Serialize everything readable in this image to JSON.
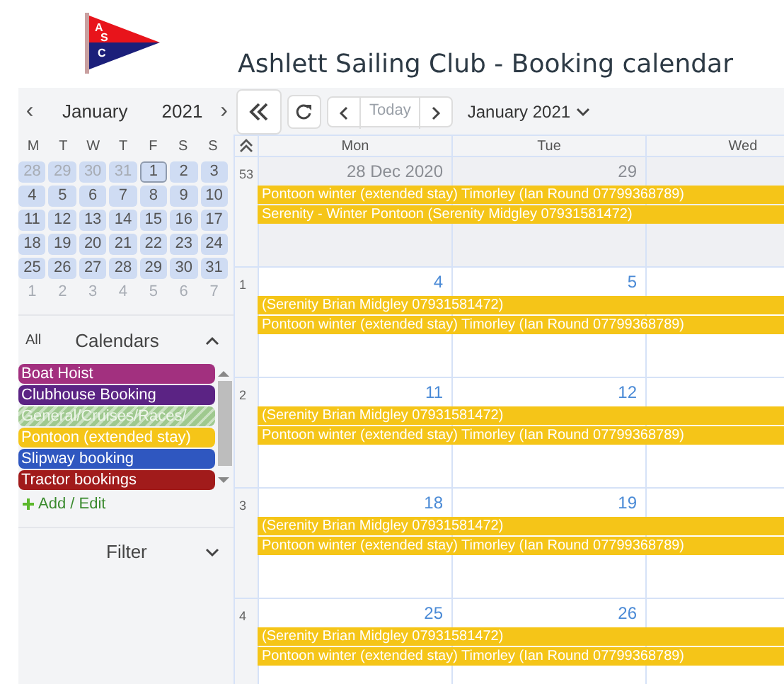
{
  "logo": {
    "letters": [
      "A",
      "S",
      "C"
    ]
  },
  "title": "Ashlett Sailing Club - Booking calendar",
  "mini_calendar": {
    "prev": "‹",
    "month": "January",
    "year": "2021",
    "next": "›",
    "weekdays": [
      "M",
      "T",
      "W",
      "T",
      "F",
      "S",
      "S"
    ],
    "weeks": [
      [
        {
          "day": "28",
          "muted": true,
          "in_range": true,
          "selected": false
        },
        {
          "day": "29",
          "muted": true,
          "in_range": true,
          "selected": false
        },
        {
          "day": "30",
          "muted": true,
          "in_range": true,
          "selected": false
        },
        {
          "day": "31",
          "muted": true,
          "in_range": true,
          "selected": false
        },
        {
          "day": "1",
          "muted": false,
          "in_range": true,
          "selected": true
        },
        {
          "day": "2",
          "muted": false,
          "in_range": true,
          "selected": false
        },
        {
          "day": "3",
          "muted": false,
          "in_range": true,
          "selected": false
        }
      ],
      [
        {
          "day": "4",
          "muted": false,
          "in_range": true,
          "selected": false
        },
        {
          "day": "5",
          "muted": false,
          "in_range": true,
          "selected": false
        },
        {
          "day": "6",
          "muted": false,
          "in_range": true,
          "selected": false
        },
        {
          "day": "7",
          "muted": false,
          "in_range": true,
          "selected": false
        },
        {
          "day": "8",
          "muted": false,
          "in_range": true,
          "selected": false
        },
        {
          "day": "9",
          "muted": false,
          "in_range": true,
          "selected": false
        },
        {
          "day": "10",
          "muted": false,
          "in_range": true,
          "selected": false
        }
      ],
      [
        {
          "day": "11",
          "muted": false,
          "in_range": true,
          "selected": false
        },
        {
          "day": "12",
          "muted": false,
          "in_range": true,
          "selected": false
        },
        {
          "day": "13",
          "muted": false,
          "in_range": true,
          "selected": false
        },
        {
          "day": "14",
          "muted": false,
          "in_range": true,
          "selected": false
        },
        {
          "day": "15",
          "muted": false,
          "in_range": true,
          "selected": false
        },
        {
          "day": "16",
          "muted": false,
          "in_range": true,
          "selected": false
        },
        {
          "day": "17",
          "muted": false,
          "in_range": true,
          "selected": false
        }
      ],
      [
        {
          "day": "18",
          "muted": false,
          "in_range": true,
          "selected": false
        },
        {
          "day": "19",
          "muted": false,
          "in_range": true,
          "selected": false
        },
        {
          "day": "20",
          "muted": false,
          "in_range": true,
          "selected": false
        },
        {
          "day": "21",
          "muted": false,
          "in_range": true,
          "selected": false
        },
        {
          "day": "22",
          "muted": false,
          "in_range": true,
          "selected": false
        },
        {
          "day": "23",
          "muted": false,
          "in_range": true,
          "selected": false
        },
        {
          "day": "24",
          "muted": false,
          "in_range": true,
          "selected": false
        }
      ],
      [
        {
          "day": "25",
          "muted": false,
          "in_range": true,
          "selected": false
        },
        {
          "day": "26",
          "muted": false,
          "in_range": true,
          "selected": false
        },
        {
          "day": "27",
          "muted": false,
          "in_range": true,
          "selected": false
        },
        {
          "day": "28",
          "muted": false,
          "in_range": true,
          "selected": false
        },
        {
          "day": "29",
          "muted": false,
          "in_range": true,
          "selected": false
        },
        {
          "day": "30",
          "muted": false,
          "in_range": true,
          "selected": false
        },
        {
          "day": "31",
          "muted": false,
          "in_range": true,
          "selected": false
        }
      ],
      [
        {
          "day": "1",
          "muted": true,
          "in_range": false,
          "selected": false
        },
        {
          "day": "2",
          "muted": true,
          "in_range": false,
          "selected": false
        },
        {
          "day": "3",
          "muted": true,
          "in_range": false,
          "selected": false
        },
        {
          "day": "4",
          "muted": true,
          "in_range": false,
          "selected": false
        },
        {
          "day": "5",
          "muted": true,
          "in_range": false,
          "selected": false
        },
        {
          "day": "6",
          "muted": true,
          "in_range": false,
          "selected": false
        },
        {
          "day": "7",
          "muted": true,
          "in_range": false,
          "selected": false
        }
      ]
    ]
  },
  "calendars": {
    "all_label": "All",
    "title": "Calendars",
    "expanded": true,
    "items": [
      {
        "label": "Boat Hoist",
        "color": "#a2307f",
        "hidden": false
      },
      {
        "label": "Clubhouse Booking",
        "color": "#5b2384",
        "hidden": false
      },
      {
        "label": "General/Cruises/Races/",
        "color": "#9fc98f",
        "hidden": true
      },
      {
        "label": "Pontoon (extended stay)",
        "color": "#f5c518",
        "hidden": false
      },
      {
        "label": "Slipway booking",
        "color": "#2f57c0",
        "hidden": false
      },
      {
        "label": "Tractor bookings",
        "color": "#a11b1b",
        "hidden": false
      }
    ],
    "add_edit": "Add / Edit"
  },
  "filter": {
    "title": "Filter",
    "expanded": false
  },
  "toolbar": {
    "today": "Today",
    "today_disabled": true,
    "period": "January 2021"
  },
  "calendar": {
    "columns": [
      "Mon",
      "Tue",
      "Wed"
    ],
    "weeks": [
      {
        "number": "53",
        "outside": true,
        "days": [
          "28 Dec 2020",
          "29"
        ],
        "events": [
          "Pontoon winter (extended stay) Timorley (Ian Round 07799368789)",
          "Serenity - Winter Pontoon (Serenity Midgley 07931581472)"
        ]
      },
      {
        "number": "1",
        "outside": false,
        "days": [
          "4",
          "5"
        ],
        "events": [
          "(Serenity Brian Midgley 07931581472)",
          "Pontoon winter (extended stay) Timorley (Ian Round 07799368789)"
        ]
      },
      {
        "number": "2",
        "outside": false,
        "days": [
          "11",
          "12"
        ],
        "events": [
          "(Serenity Brian Midgley 07931581472)",
          "Pontoon winter (extended stay) Timorley (Ian Round 07799368789)"
        ]
      },
      {
        "number": "3",
        "outside": false,
        "days": [
          "18",
          "19"
        ],
        "events": [
          "(Serenity Brian Midgley 07931581472)",
          "Pontoon winter (extended stay) Timorley (Ian Round 07799368789)"
        ]
      },
      {
        "number": "4",
        "outside": false,
        "days": [
          "25",
          "26"
        ],
        "events": [
          "(Serenity Brian Midgley 07931581472)",
          "Pontoon winter (extended stay) Timorley (Ian Round 07799368789)"
        ]
      }
    ]
  }
}
